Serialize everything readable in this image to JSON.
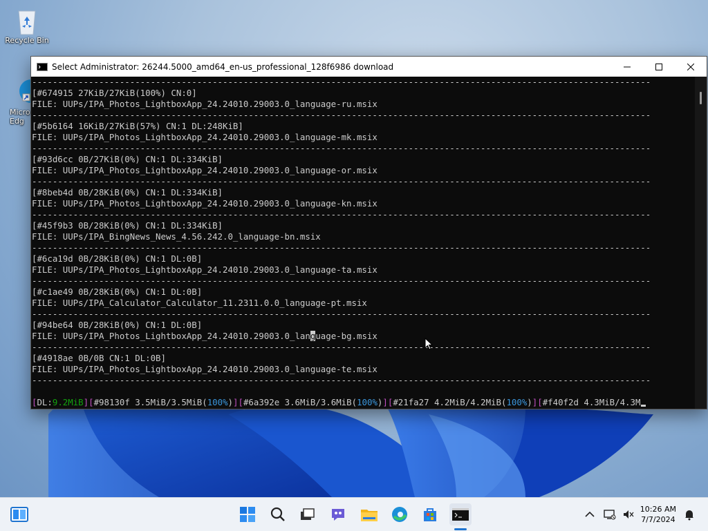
{
  "desktop": {
    "icons": [
      {
        "label": "Recycle Bin"
      },
      {
        "label": "Micro\nEdg"
      }
    ]
  },
  "window": {
    "title": "Select Administrator:  26244.5000_amd64_en-us_professional_128f6986 download",
    "controls": [
      "minimize",
      "maximize",
      "close"
    ]
  },
  "console": {
    "lines": [
      "------------------------------------------------------------------------------------------------------------------------",
      "[#674915 27KiB/27KiB(100%) CN:0]",
      "FILE: UUPs/IPA_Photos_LightboxApp_24.24010.29003.0_language-ru.msix",
      "------------------------------------------------------------------------------------------------------------------------",
      "[#5b6164 16KiB/27KiB(57%) CN:1 DL:248KiB]",
      "FILE: UUPs/IPA_Photos_LightboxApp_24.24010.29003.0_language-mk.msix",
      "------------------------------------------------------------------------------------------------------------------------",
      "[#93d6cc 0B/27KiB(0%) CN:1 DL:334KiB]",
      "FILE: UUPs/IPA_Photos_LightboxApp_24.24010.29003.0_language-or.msix",
      "------------------------------------------------------------------------------------------------------------------------",
      "[#8beb4d 0B/28KiB(0%) CN:1 DL:334KiB]",
      "FILE: UUPs/IPA_Photos_LightboxApp_24.24010.29003.0_language-kn.msix",
      "------------------------------------------------------------------------------------------------------------------------",
      "[#45f9b3 0B/28KiB(0%) CN:1 DL:334KiB]",
      "FILE: UUPs/IPA_BingNews_News_4.56.242.0_language-bn.msix",
      "------------------------------------------------------------------------------------------------------------------------",
      "[#6ca19d 0B/28KiB(0%) CN:1 DL:0B]",
      "FILE: UUPs/IPA_Photos_LightboxApp_24.24010.29003.0_language-ta.msix",
      "------------------------------------------------------------------------------------------------------------------------",
      "[#c1ae49 0B/28KiB(0%) CN:1 DL:0B]",
      "FILE: UUPs/IPA_Calculator_Calculator_11.2311.0.0_language-pt.msix",
      "------------------------------------------------------------------------------------------------------------------------",
      "[#94be64 0B/28KiB(0%) CN:1 DL:0B]",
      "FILE: UUPs/IPA_Photos_LightboxApp_24.24010.29003.0_language-bg.msix",
      "------------------------------------------------------------------------------------------------------------------------",
      "[#4918ae 0B/0B CN:1 DL:0B]",
      "FILE: UUPs/IPA_Photos_LightboxApp_24.24010.29003.0_language-te.msix",
      "------------------------------------------------------------------------------------------------------------------------",
      ""
    ],
    "highlight": {
      "line": 23,
      "before": "FILE: UUPs/IPA_Photos_LightboxApp_24.24010.29003.0_lan",
      "char": "g",
      "after": "uage-bg.msix"
    },
    "status_segments": [
      {
        "text": "[",
        "c": "br"
      },
      {
        "text": "DL:",
        "c": "w"
      },
      {
        "text": "9.2MiB",
        "c": "g"
      },
      {
        "text": "]",
        "c": "br"
      },
      {
        "text": "[",
        "c": "br"
      },
      {
        "text": "#98130f 3.5MiB/3.5MiB",
        "c": "w"
      },
      {
        "text": "(",
        "c": "w"
      },
      {
        "text": "100%",
        "c": "b"
      },
      {
        "text": ")",
        "c": "w"
      },
      {
        "text": "]",
        "c": "br"
      },
      {
        "text": "[",
        "c": "br"
      },
      {
        "text": "#6a392e 3.6MiB/3.6MiB",
        "c": "w"
      },
      {
        "text": "(",
        "c": "w"
      },
      {
        "text": "100%",
        "c": "b"
      },
      {
        "text": ")",
        "c": "w"
      },
      {
        "text": "]",
        "c": "br"
      },
      {
        "text": "[",
        "c": "br"
      },
      {
        "text": "#21fa27 4.2MiB/4.2MiB",
        "c": "w"
      },
      {
        "text": "(",
        "c": "w"
      },
      {
        "text": "100%",
        "c": "b"
      },
      {
        "text": ")",
        "c": "w"
      },
      {
        "text": "]",
        "c": "br"
      },
      {
        "text": "[",
        "c": "br"
      },
      {
        "text": "#f40f2d 4.3MiB/4.3M",
        "c": "w"
      }
    ],
    "colors": {
      "background": "#0c0c0c",
      "text": "#cccccc",
      "bracket": "#c050c0",
      "speed": "#13a10e",
      "percent": "#3a96dd"
    }
  },
  "taskbar": {
    "items": [
      "widgets-icon",
      "start-icon",
      "search-icon",
      "task-view-icon",
      "chat-icon",
      "file-explorer-icon",
      "edge-icon",
      "store-icon",
      "terminal-icon"
    ],
    "clock": {
      "time": "10:26 AM",
      "date": "7/7/2024"
    },
    "tray": [
      "chevron-up-icon",
      "network-icon",
      "volume-icon",
      "notification-icon"
    ]
  }
}
